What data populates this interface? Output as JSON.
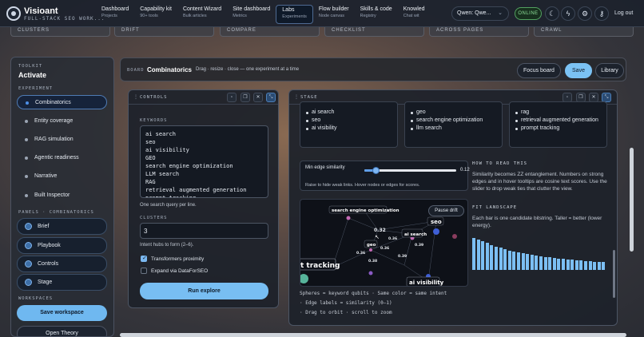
{
  "brand": {
    "name": "Visioant",
    "tagline": "FULL-STACK SEO WORK..."
  },
  "nav": [
    {
      "label": "Dashboard",
      "sub": "Projects"
    },
    {
      "label": "Capability kit",
      "sub": "90+ tools"
    },
    {
      "label": "Content Wizard",
      "sub": "Bulk articles"
    },
    {
      "label": "Site dashboard",
      "sub": "Metrics"
    },
    {
      "label": "Labs",
      "sub": "Experiments"
    },
    {
      "label": "Flow builder",
      "sub": "Node canvas"
    },
    {
      "label": "Skills & code",
      "sub": "Registry"
    },
    {
      "label": "Knowled",
      "sub": "Chat wit"
    }
  ],
  "model": {
    "value": "Qwen: Qwe..."
  },
  "status": "ONLINE",
  "icons": [
    "moon-icon",
    "bolt-icon",
    "gear-icon",
    "key-icon"
  ],
  "logout": "Log out",
  "strip": [
    "CLUSTERS",
    "DRIFT",
    "COMPARE",
    "CHECKLIST",
    "ACROSS PAGES",
    "CRAWL"
  ],
  "toolkit": {
    "label": "TOOLKIT",
    "title": "Activate",
    "experiment_label": "EXPERIMENT",
    "experiments": [
      "Combinatorics",
      "Entity coverage",
      "RAG simulation",
      "Agentic readiness",
      "Narrative",
      "Built Inspector"
    ],
    "panels_label": "PANELS · COMBINATORICS",
    "panels": [
      "Brief",
      "Playbook",
      "Controls",
      "Stage"
    ],
    "workspaces_label": "WORKSPACES",
    "save_workspace": "Save workspace",
    "open_workspace": "Open Theory"
  },
  "board": {
    "label": "BOARD",
    "name": "Combinatorics",
    "hint": "Drag · resize · close — one experiment at a time",
    "focus": "Focus board",
    "save": "Save",
    "library": "Library"
  },
  "controls": {
    "title": "CONTROLS",
    "keywords_label": "KEYWORDS",
    "keywords": "ai search\nseo\nai visibility\nGEO\nsearch engine optimization\nLLM search\nRAG\nretrieval augmented generation\nprompt tracking",
    "keywords_help": "One search query per line.",
    "clusters_label": "CLUSTERS",
    "clusters_value": "3",
    "clusters_help": "Intent hubs to form (2–6).",
    "transformers": "Transformers proximity",
    "transformers_checked": true,
    "expand": "Expand via DataForSEO",
    "expand_checked": false,
    "run": "Run explore"
  },
  "stage": {
    "title": "STAGE",
    "hubs": [
      [
        "ai search",
        "seo",
        "ai visibility"
      ],
      [
        "geo",
        "search engine optimization",
        "llm search"
      ],
      [
        "rag",
        "retrieval augmented generation",
        "prompt tracking"
      ]
    ],
    "edge": {
      "label": "Min edge similarity",
      "value": "0.12",
      "fraction": 0.12,
      "hint": "Raise to hide weak links. Hover nodes or edges for scores."
    },
    "pause": "Pause drift",
    "graph_labels": [
      "search engine optimization",
      "seo",
      "ai search",
      "geo",
      "t tracking",
      "ai visibility"
    ],
    "graph_edge_labels": [
      "0.32",
      "0.36",
      "0.39",
      "0.36",
      "0.36",
      "0.39",
      "0.38",
      "0.37",
      "0.36"
    ],
    "legend": [
      "Spheres = keyword qubits · Same color = same intent",
      "· Edge labels = similarity (0–1)",
      "· Drag to orbit · scroll to zoom"
    ],
    "how_label": "HOW TO READ THIS",
    "how_text": "Similarity becomes ZZ entanglement. Numbers on strong edges and in hover tooltips are cosine text scores. Use the slider to drop weak ties that clutter the view.",
    "fit_label": "FIT LANDSCAPE",
    "fit_text": "Each bar is one candidate bitstring. Taller = better (lower energy).",
    "fit_bars": [
      0.95,
      0.9,
      0.86,
      0.8,
      0.74,
      0.7,
      0.66,
      0.62,
      0.58,
      0.55,
      0.52,
      0.5,
      0.47,
      0.45,
      0.43,
      0.41,
      0.39,
      0.37,
      0.36,
      0.34,
      0.33,
      0.32,
      0.3,
      0.29,
      0.28,
      0.27,
      0.26,
      0.25,
      0.24,
      0.23
    ]
  }
}
